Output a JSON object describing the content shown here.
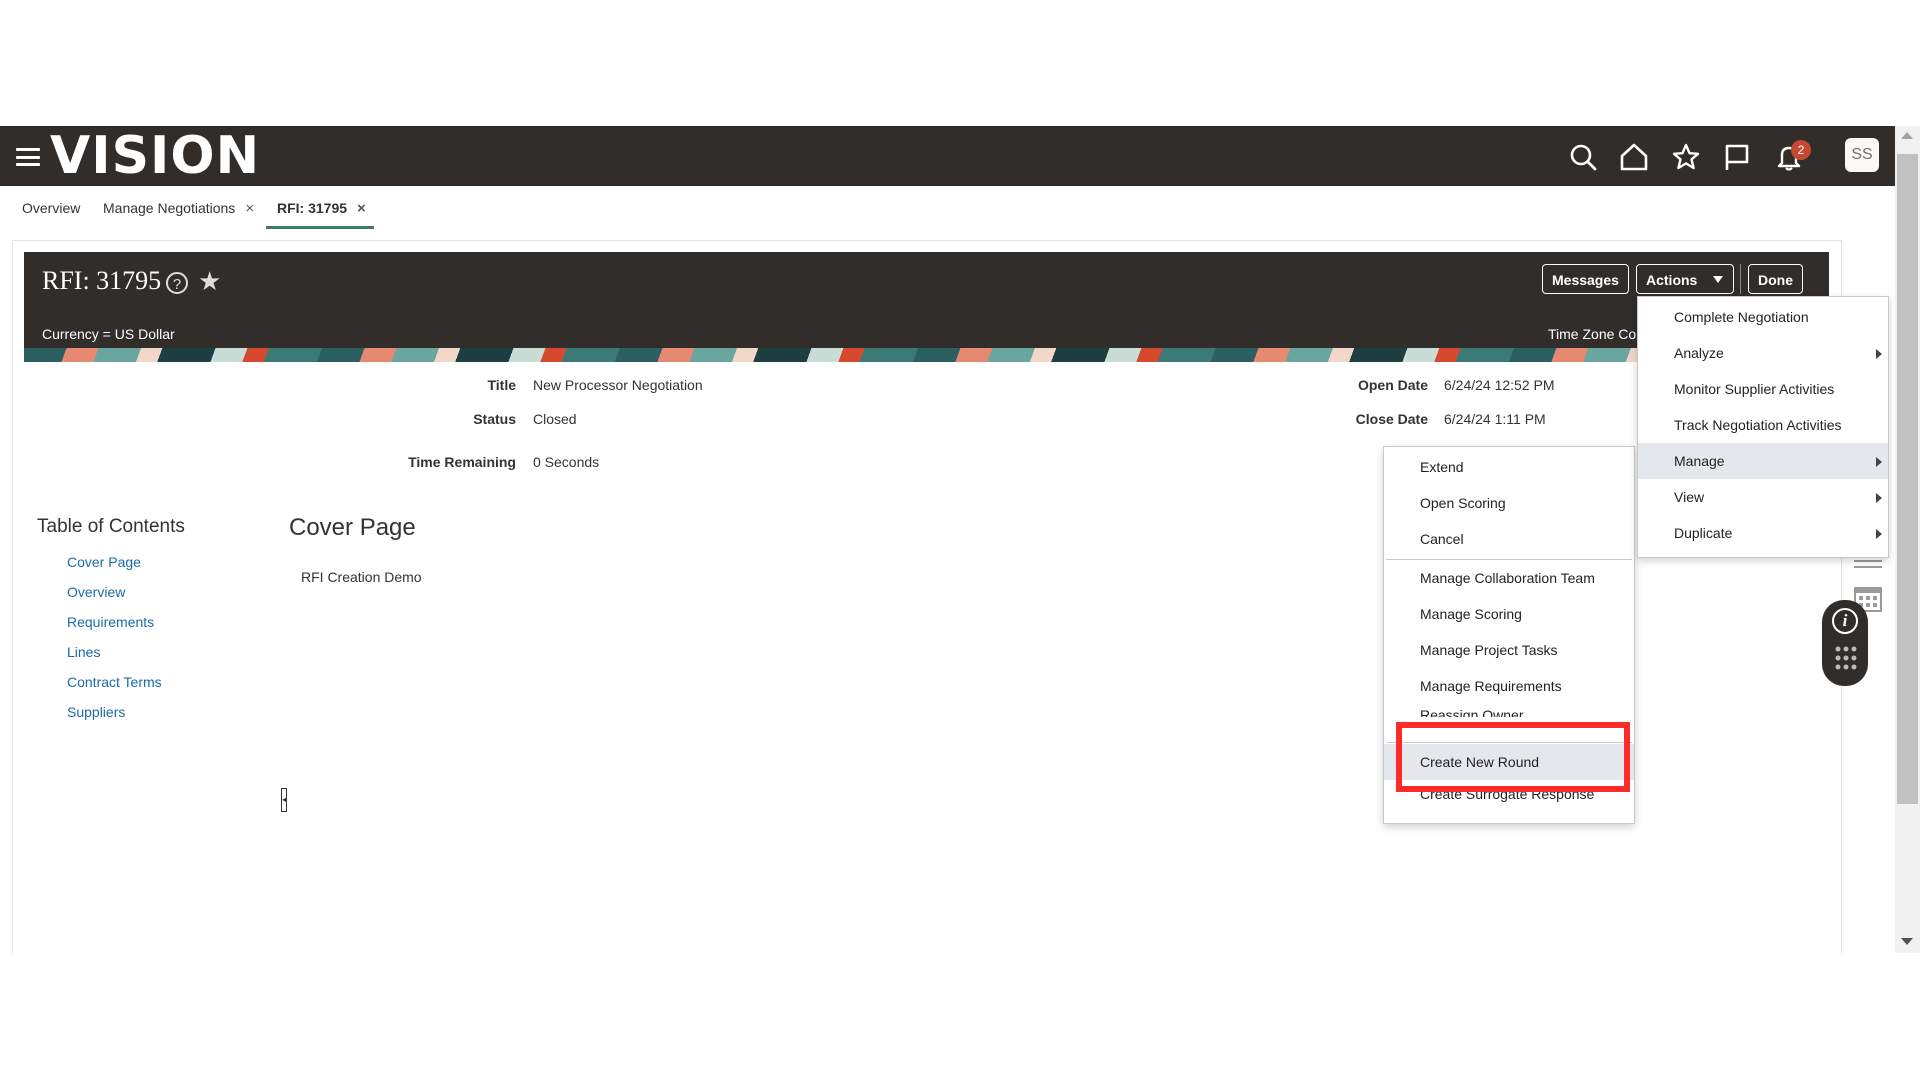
{
  "app": {
    "logo": "VISION",
    "notification_count": "2",
    "user_initials": "SS"
  },
  "header_icons": [
    "search-icon",
    "home-icon",
    "star-icon",
    "flag-icon",
    "bell-icon"
  ],
  "tabs": [
    {
      "label": "Overview",
      "closable": false,
      "active": false
    },
    {
      "label": "Manage Negotiations",
      "closable": true,
      "active": false
    },
    {
      "label": "RFI: 31795",
      "closable": true,
      "active": true
    }
  ],
  "tab_close_glyph": "×",
  "page": {
    "title": "RFI: 31795",
    "currency": "Currency = US Dollar",
    "timezone": "Time Zone Co",
    "buttons": {
      "messages": "Messages",
      "actions": "Actions",
      "done": "Done"
    }
  },
  "fields": {
    "title_label": "Title",
    "title_value": "New Processor Negotiation",
    "status_label": "Status",
    "status_value": "Closed",
    "time_remaining_label": "Time Remaining",
    "time_remaining_value": "0 Seconds",
    "open_date_label": "Open Date",
    "open_date_value": "6/24/24 12:52 PM",
    "close_date_label": "Close Date",
    "close_date_value": "6/24/24 1:11 PM"
  },
  "toc": {
    "title": "Table of Contents",
    "items": [
      "Cover Page",
      "Overview",
      "Requirements",
      "Lines",
      "Contract Terms",
      "Suppliers"
    ]
  },
  "cover": {
    "title": "Cover Page",
    "text": "RFI Creation Demo"
  },
  "actions_menu": [
    {
      "label": "Complete Negotiation",
      "submenu": false
    },
    {
      "label": "Analyze",
      "submenu": true
    },
    {
      "label": "Monitor Supplier Activities",
      "submenu": false
    },
    {
      "label": "Track Negotiation Activities",
      "submenu": false
    },
    {
      "label": "Manage",
      "submenu": true,
      "highlighted": true
    },
    {
      "label": "View",
      "submenu": true
    },
    {
      "label": "Duplicate",
      "submenu": true
    }
  ],
  "manage_menu": {
    "group1": [
      "Extend",
      "Open Scoring",
      "Cancel"
    ],
    "group2": [
      "Manage Collaboration Team",
      "Manage Scoring",
      "Manage Project Tasks",
      "Manage Requirements",
      "Reassign Owner"
    ],
    "create_new_round": "Create New Round",
    "create_surrogate": "Create Surrogate Response"
  },
  "colors": {
    "header_bg": "#312d2a",
    "link": "#1b6aa5",
    "highlight_box": "#ff2a2a",
    "badge": "#c74634",
    "tab_underline": "#3f7e6a"
  }
}
